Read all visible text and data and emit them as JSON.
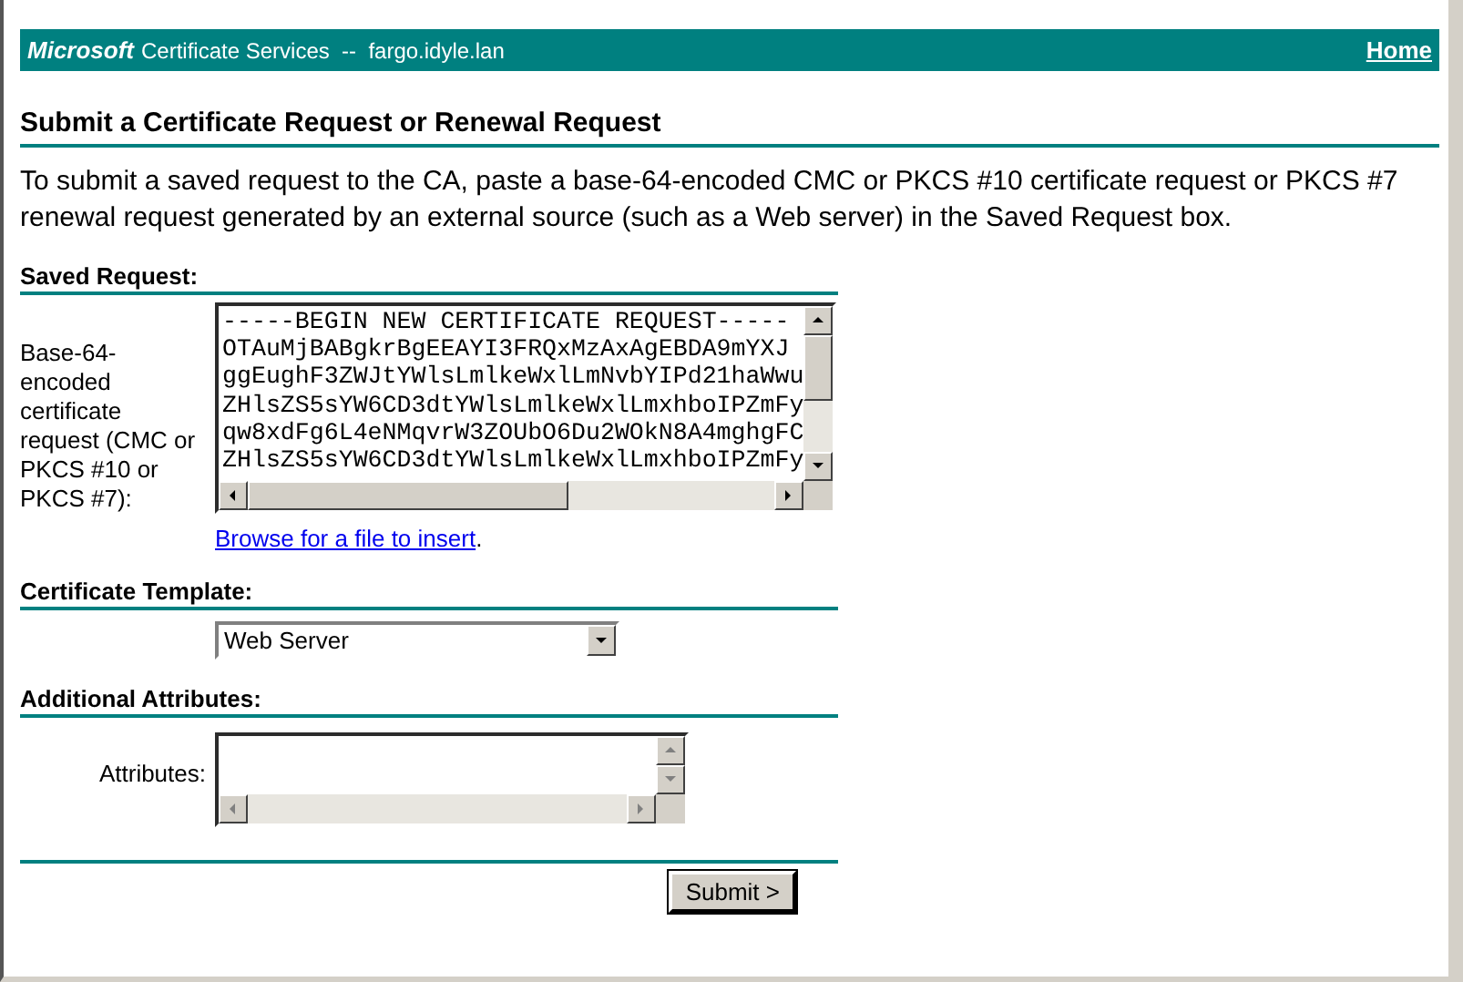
{
  "header": {
    "brand": "Microsoft",
    "title": "Certificate Services  --  fargo.idyle.lan",
    "home_link": "Home"
  },
  "page_title": "Submit a Certificate Request or Renewal Request",
  "intro": "To submit a saved request to the CA, paste a base-64-encoded CMC or PKCS #10 certificate request or PKCS #7 renewal request generated by an external source (such as a Web server) in the Saved Request box.",
  "saved_request": {
    "heading": "Saved Request:",
    "label": "Base-64-encoded certificate request (CMC or PKCS #10 or PKCS #7):",
    "lines": [
      "-----BEGIN NEW CERTIFICATE REQUEST-----",
      "OTAuMjBABgkrBgEEAYI3FRQxMzAxAgEBDA9mYXJ",
      "ggEughF3ZWJtYWlsLmlkeWxlLmNvbYIPd21haWwu",
      "ZHlsZS5sYW6CD3dtYWlsLmlkeWxlLmxhboIPZmFy",
      "qw8xdFg6L4eNMqvrW3ZOUbO6Du2WOkN8A4mghgFC",
      "ZHlsZS5sYW6CD3dtYWlsLmlkeWxlLmxhboIPZmFy"
    ],
    "browse_link": "Browse for a file to insert",
    "browse_suffix": "."
  },
  "certificate_template": {
    "heading": "Certificate Template:",
    "value": "Web Server"
  },
  "additional_attributes": {
    "heading": "Additional Attributes:",
    "label": "Attributes:"
  },
  "submit_button": "Submit >"
}
